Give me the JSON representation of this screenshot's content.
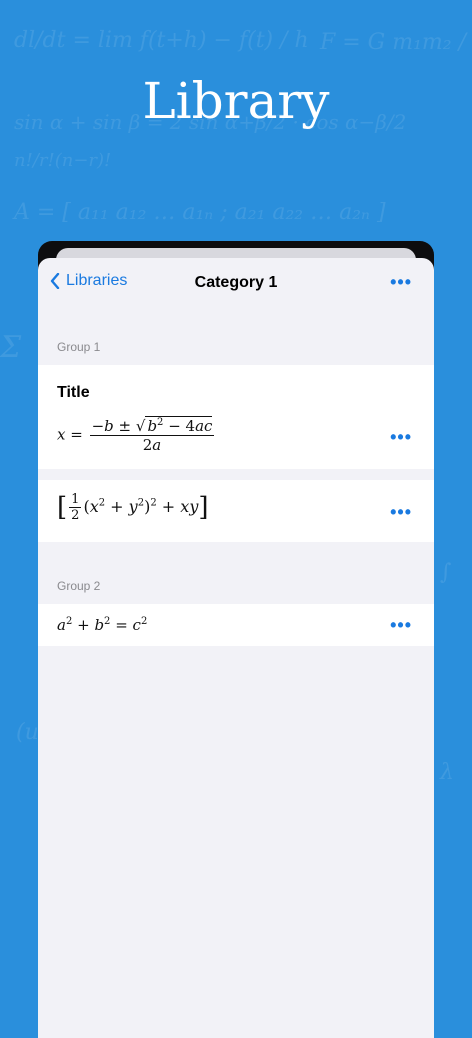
{
  "hero": {
    "title": "Library"
  },
  "navbar": {
    "back_label": "Libraries",
    "title": "Category 1",
    "more": "•••"
  },
  "groups": [
    {
      "label": "Group 1"
    },
    {
      "label": "Group 2"
    }
  ],
  "rows": [
    {
      "title": "Title",
      "formula": "x = (−b ± √(b² − 4ac)) / 2a",
      "more": "•••"
    },
    {
      "formula": "[ ½ (x² + y²)² + xy ]",
      "more": "•••"
    },
    {
      "formula": "a² + b² = c²",
      "more": "•••"
    }
  ],
  "colors": {
    "background": "#2a8fdc",
    "accent": "#1a7ae0"
  }
}
